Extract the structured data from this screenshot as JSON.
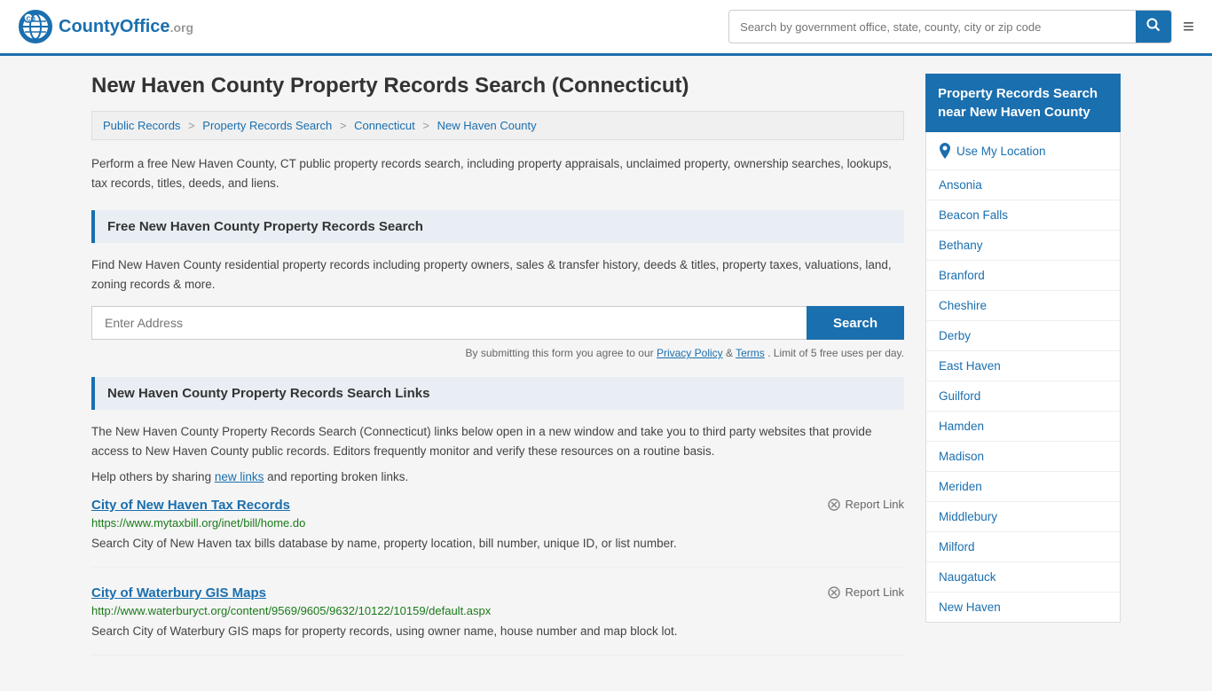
{
  "header": {
    "logo_text": "CountyOffice",
    "logo_suffix": ".org",
    "search_placeholder": "Search by government office, state, county, city or zip code",
    "search_button_label": "🔍"
  },
  "page": {
    "title": "New Haven County Property Records Search (Connecticut)",
    "breadcrumb": [
      {
        "label": "Public Records",
        "href": "#"
      },
      {
        "label": "Property Records Search",
        "href": "#"
      },
      {
        "label": "Connecticut",
        "href": "#"
      },
      {
        "label": "New Haven County",
        "href": "#"
      }
    ],
    "description": "Perform a free New Haven County, CT public property records search, including property appraisals, unclaimed property, ownership searches, lookups, tax records, titles, deeds, and liens."
  },
  "free_search": {
    "heading": "Free New Haven County Property Records Search",
    "description": "Find New Haven County residential property records including property owners, sales & transfer history, deeds & titles, property taxes, valuations, land, zoning records & more.",
    "address_placeholder": "Enter Address",
    "search_button": "Search",
    "form_notice": "By submitting this form you agree to our",
    "privacy_label": "Privacy Policy",
    "terms_label": "Terms",
    "limit_notice": ". Limit of 5 free uses per day."
  },
  "links_section": {
    "heading": "New Haven County Property Records Search Links",
    "description": "The New Haven County Property Records Search (Connecticut) links below open in a new window and take you to third party websites that provide access to New Haven County public records. Editors frequently monitor and verify these resources on a routine basis.",
    "share_text": "Help others by sharing",
    "new_links_label": "new links",
    "broken_text": "and reporting broken links.",
    "links": [
      {
        "title": "City of New Haven Tax Records",
        "url": "https://www.mytaxbill.org/inet/bill/home.do",
        "description": "Search City of New Haven tax bills database by name, property location, bill number, unique ID, or list number.",
        "report_label": "Report Link"
      },
      {
        "title": "City of Waterbury GIS Maps",
        "url": "http://www.waterburyct.org/content/9569/9605/9632/10122/10159/default.aspx",
        "description": "Search City of Waterbury GIS maps for property records, using owner name, house number and map block lot.",
        "report_label": "Report Link"
      }
    ]
  },
  "sidebar": {
    "header": "Property Records Search near New Haven County",
    "use_my_location": "Use My Location",
    "nearby_places": [
      "Ansonia",
      "Beacon Falls",
      "Bethany",
      "Branford",
      "Cheshire",
      "Derby",
      "East Haven",
      "Guilford",
      "Hamden",
      "Madison",
      "Meriden",
      "Middlebury",
      "Milford",
      "Naugatuck",
      "New Haven"
    ]
  }
}
